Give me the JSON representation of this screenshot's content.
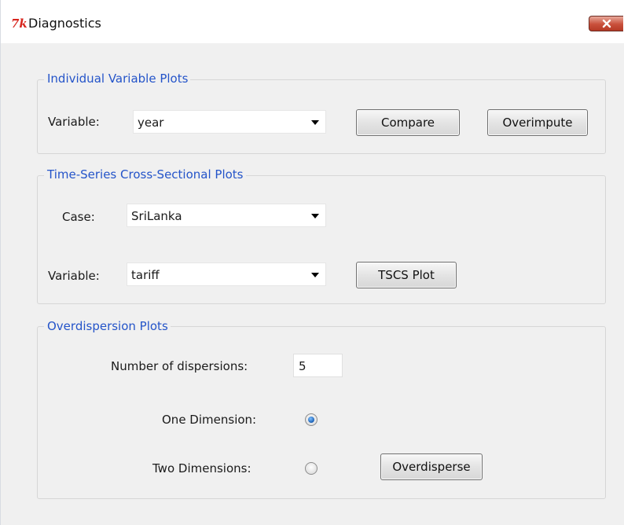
{
  "window": {
    "title": "Diagnostics"
  },
  "individual": {
    "legend": "Individual Variable Plots",
    "variable_label": "Variable:",
    "variable_value": "year",
    "compare_label": "Compare",
    "overimpute_label": "Overimpute"
  },
  "tscs": {
    "legend": "Time-Series Cross-Sectional Plots",
    "case_label": "Case:",
    "case_value": "SriLanka",
    "variable_label": "Variable:",
    "variable_value": "tariff",
    "plot_label": "TSCS Plot"
  },
  "overdispersion": {
    "legend": "Overdispersion Plots",
    "num_label": "Number of dispersions:",
    "num_value": "5",
    "one_label": "One Dimension:",
    "one_selected": true,
    "two_label": "Two Dimensions:",
    "two_selected": false,
    "overdisperse_label": "Overdisperse"
  },
  "colors": {
    "legend_text": "#2454c9",
    "close_button": "#c9503b",
    "tk_logo": "#d8261e"
  },
  "icons": {
    "title": "tk-feather-icon",
    "close": "close-x-icon",
    "dropdown": "dropdown-arrow-icon"
  }
}
